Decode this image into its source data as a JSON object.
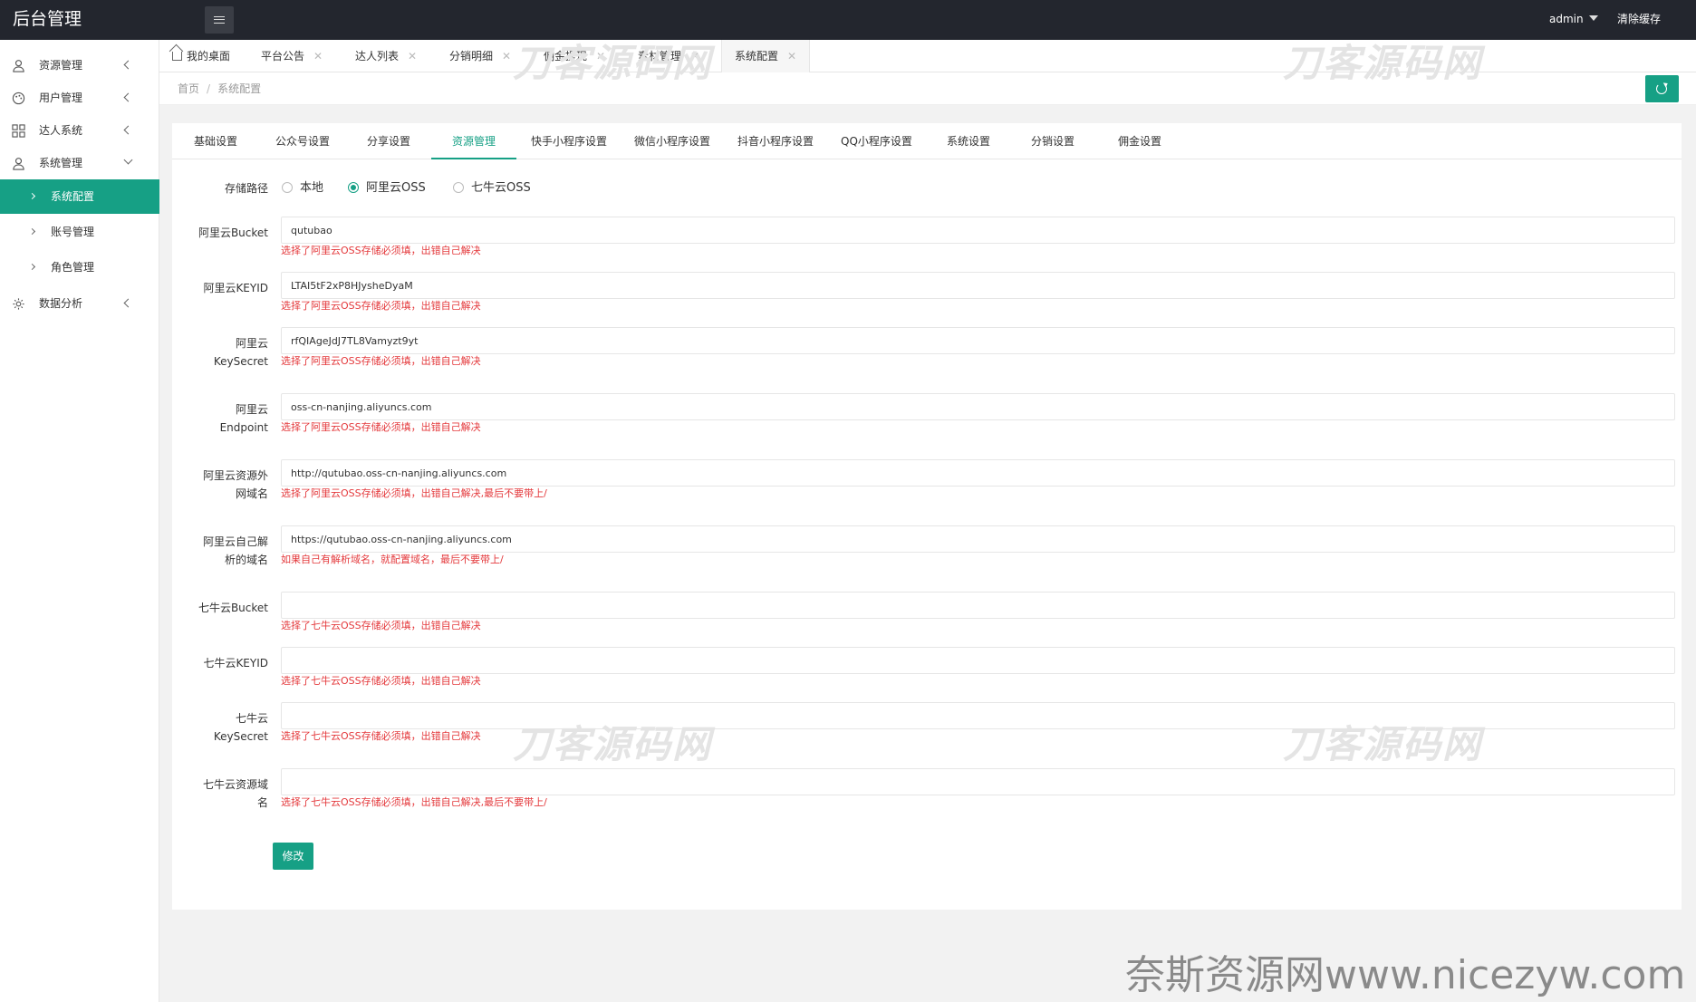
{
  "header": {
    "logo": "后台管理",
    "user": "admin",
    "clear_cache": "清除缓存"
  },
  "sidebar": {
    "items": [
      {
        "label": "资源管理",
        "icon": "user-icon"
      },
      {
        "label": "用户管理",
        "icon": "palette-icon"
      },
      {
        "label": "达人系统",
        "icon": "grid-icon"
      },
      {
        "label": "系统管理",
        "icon": "user-icon"
      },
      {
        "label": "数据分析",
        "icon": "gear-icon"
      }
    ],
    "subitems": [
      {
        "label": "系统配置",
        "active": true
      },
      {
        "label": "账号管理"
      },
      {
        "label": "角色管理"
      }
    ]
  },
  "tabs": [
    {
      "label": "我的桌面"
    },
    {
      "label": "平台公告"
    },
    {
      "label": "达人列表"
    },
    {
      "label": "分销明细"
    },
    {
      "label": "佣金提现"
    },
    {
      "label": "素材管理"
    },
    {
      "label": "系统配置",
      "active": true
    }
  ],
  "breadcrumb": {
    "home": "首页",
    "sep": "/",
    "current": "系统配置"
  },
  "subtabs": [
    "基础设置",
    "公众号设置",
    "分享设置",
    "资源管理",
    "快手小程序设置",
    "微信小程序设置",
    "抖音小程序设置",
    "QQ小程序设置",
    "系统设置",
    "分销设置",
    "佣金设置"
  ],
  "form": {
    "storage_label": "存储路径",
    "storage_options": [
      "本地",
      "阿里云OSS",
      "七牛云OSS"
    ],
    "storage_selected": "阿里云OSS",
    "fields": [
      {
        "label1": "阿里云Bucket",
        "label2": "",
        "value": "qutubao",
        "hint": "选择了阿里云OSS存储必须填，出错自己解决"
      },
      {
        "label1": "阿里云KEYID",
        "label2": "",
        "value": "LTAI5tF2xP8HJysheDyaM",
        "hint": "选择了阿里云OSS存储必须填，出错自己解决"
      },
      {
        "label1": "阿里云",
        "label2": "KeySecret",
        "value": "rfQIAgeJdJ7TL8Vamyzt9yt",
        "hint": "选择了阿里云OSS存储必须填，出错自己解决"
      },
      {
        "label1": "阿里云",
        "label2": "Endpoint",
        "value": "oss-cn-nanjing.aliyuncs.com",
        "hint": "选择了阿里云OSS存储必须填，出错自己解决"
      },
      {
        "label1": "阿里云资源外",
        "label2": "网域名",
        "value": "http://qutubao.oss-cn-nanjing.aliyuncs.com",
        "hint": "选择了阿里云OSS存储必须填，出错自己解决,最后不要带上/"
      },
      {
        "label1": "阿里云自己解",
        "label2": "析的域名",
        "value": "https://qutubao.oss-cn-nanjing.aliyuncs.com",
        "hint": "如果自己有解析域名，就配置域名，最后不要带上/"
      },
      {
        "label1": "七牛云Bucket",
        "label2": "",
        "value": "",
        "hint": "选择了七牛云OSS存储必须填，出错自己解决"
      },
      {
        "label1": "七牛云KEYID",
        "label2": "",
        "value": "",
        "hint": "选择了七牛云OSS存储必须填，出错自己解决"
      },
      {
        "label1": "七牛云",
        "label2": "KeySecret",
        "value": "",
        "hint": "选择了七牛云OSS存储必须填，出错自己解决"
      },
      {
        "label1": "七牛云资源域",
        "label2": "名",
        "value": "",
        "hint": "选择了七牛云OSS存储必须填，出错自己解决,最后不要带上/"
      }
    ],
    "submit_label": "修改"
  },
  "watermark": {
    "text": "刀客源码网",
    "footer": "奈斯资源网www.nicezyw.com"
  },
  "colors": {
    "accent": "#16a085",
    "topbar": "#23262e",
    "hint": "#e4393c"
  }
}
